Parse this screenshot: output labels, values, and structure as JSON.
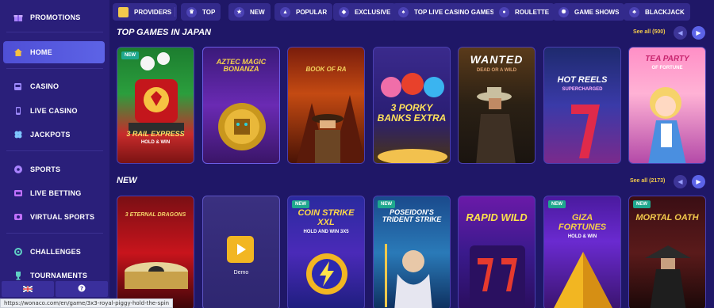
{
  "sidebar": {
    "items": [
      {
        "label": "PROMOTIONS",
        "icon": "gift-icon"
      },
      {
        "label": "HOME",
        "icon": "home-icon",
        "active": true
      },
      {
        "label": "CASINO",
        "icon": "slot-icon"
      },
      {
        "label": "LIVE CASINO",
        "icon": "phone-icon"
      },
      {
        "label": "JACKPOTS",
        "icon": "clover-icon"
      },
      {
        "label": "SPORTS",
        "icon": "ball-icon"
      },
      {
        "label": "LIVE BETTING",
        "icon": "live-icon"
      },
      {
        "label": "VIRTUAL SPORTS",
        "icon": "virtual-icon"
      },
      {
        "label": "CHALLENGES",
        "icon": "target-icon"
      },
      {
        "label": "TOURNAMENTS",
        "icon": "trophy-icon"
      }
    ],
    "bottom": {
      "flag_icon": "uk-flag-icon",
      "help_icon": "help-icon"
    }
  },
  "categories": [
    {
      "label": "PROVIDERS",
      "icon": "providers-icon"
    },
    {
      "label": "TOP",
      "icon": "crown-icon"
    },
    {
      "label": "NEW",
      "icon": "new-icon"
    },
    {
      "label": "POPULAR",
      "icon": "fire-icon"
    },
    {
      "label": "EXCLUSIVE",
      "icon": "diamond-icon"
    },
    {
      "label": "TOP LIVE CASINO GAMES",
      "icon": "live-cards-icon"
    },
    {
      "label": "ROULETTE",
      "icon": "roulette-icon"
    },
    {
      "label": "GAME SHOWS",
      "icon": "wheel-icon"
    },
    {
      "label": "BLACKJACK",
      "icon": "cards-icon"
    }
  ],
  "sections": {
    "top": {
      "title": "TOP GAMES IN JAPAN",
      "see_all": "See all (500)"
    },
    "new": {
      "title": "NEW",
      "see_all": "See all (2173)"
    }
  },
  "top_games": [
    {
      "title": "3 RAIL EXPRESS",
      "subtitle": "HOLD & WIN",
      "badge": "NEW"
    },
    {
      "title": "AZTEC MAGIC BONANZA",
      "subtitle": ""
    },
    {
      "title": "BOOK OF RA",
      "subtitle": ""
    },
    {
      "title": "3 PORKY BANKS EXTRA",
      "subtitle": ""
    },
    {
      "title": "WANTED",
      "subtitle": "DEAD OR A WILD"
    },
    {
      "title": "HOT REELS",
      "subtitle": "SUPERCHARGED"
    },
    {
      "title": "TEA PARTY",
      "subtitle": "OF FORTUNE"
    }
  ],
  "new_games": [
    {
      "title": "3 ETERNAL DRAGONS",
      "subtitle": "",
      "badge": ""
    },
    {
      "title": "",
      "subtitle": "",
      "demo_label": "Demo"
    },
    {
      "title": "COIN STRIKE XXL",
      "subtitle": "HOLD AND WIN 3X5",
      "badge": "NEW"
    },
    {
      "title": "POSEIDON'S TRIDENT STRIKE",
      "subtitle": "",
      "badge": "NEW"
    },
    {
      "title": "RAPID WILD",
      "subtitle": "",
      "badge": ""
    },
    {
      "title": "GIZA FORTUNES",
      "subtitle": "HOLD & WIN",
      "badge": "NEW"
    },
    {
      "title": "MORTAL OATH",
      "subtitle": "",
      "badge": "NEW"
    }
  ],
  "statusbar": {
    "url": "https://wonaco.com/en/game/3x3-royal-piggy-hold-the-spin"
  },
  "colors": {
    "background": "#1f1767",
    "sidebar": "#2a1f7a",
    "accent": "#5d63e6",
    "see_all": "#f2c94c",
    "badge_new": "#1fa88e"
  }
}
